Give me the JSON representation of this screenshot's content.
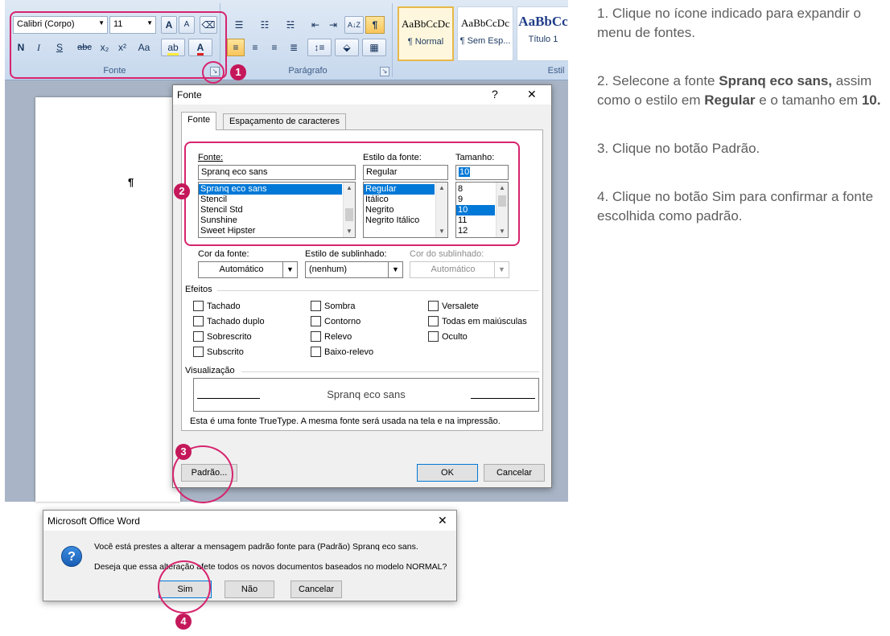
{
  "ribbon": {
    "font_name": "Calibri (Corpo)",
    "font_size": "11",
    "font_group_label": "Fonte",
    "paragraph_group_label": "Parágrafo",
    "styles_group_label": "Estil",
    "format_buttons": [
      "N",
      "I",
      "S",
      "abc",
      "x₂",
      "x²",
      "Aa"
    ],
    "grow_label": "A",
    "shrink_label": "A",
    "pilcrow_label": "¶",
    "sort_label": "A↓Z",
    "styles": [
      {
        "sample": "AaBbCcDc",
        "name": "¶ Normal"
      },
      {
        "sample": "AaBbCcDc",
        "name": "¶ Sem Esp..."
      },
      {
        "sample": "AaBbCc",
        "name": "Título 1"
      }
    ]
  },
  "document": {
    "pilcrow": "¶"
  },
  "font_dialog": {
    "title": "Fonte",
    "help": "?",
    "close": "✕",
    "tabs": [
      "Fonte",
      "Espaçamento de caracteres"
    ],
    "font_label": "Fonte:",
    "font_value": "Spranq eco sans",
    "font_list": [
      "Spranq eco sans",
      "Stencil",
      "Stencil Std",
      "Sunshine",
      "Sweet Hipster"
    ],
    "style_label": "Estilo da fonte:",
    "style_value": "Regular",
    "style_list": [
      "Regular",
      "Itálico",
      "Negrito",
      "Negrito Itálico"
    ],
    "size_label": "Tamanho:",
    "size_value": "10",
    "size_list": [
      "8",
      "9",
      "10",
      "11",
      "12"
    ],
    "color_label": "Cor da fonte:",
    "color_value": "Automático",
    "underline_label": "Estilo de sublinhado:",
    "underline_value": "(nenhum)",
    "underline_color_label": "Cor do sublinhado:",
    "underline_color_value": "Automático",
    "effects_label": "Efeitos",
    "effects": [
      "Tachado",
      "Sombra",
      "Versalete",
      "Tachado duplo",
      "Contorno",
      "Todas em maiúsculas",
      "Sobrescrito",
      "Relevo",
      "Oculto",
      "Subscrito",
      "Baixo-relevo"
    ],
    "preview_label": "Visualização",
    "preview_text": "Spranq eco sans",
    "truetype_note": "Esta é uma fonte TrueType. A mesma fonte será usada na tela e na impressão.",
    "default_button": "Padrão...",
    "ok_button": "OK",
    "cancel_button": "Cancelar"
  },
  "confirm_dialog": {
    "title": "Microsoft Office Word",
    "close": "✕",
    "icon": "?",
    "message1": "Você está prestes a alterar a mensagem padrão fonte para (Padrão) Spranq eco sans.",
    "message2": "Deseja que essa alteração afete todos os novos documentos baseados no modelo NORMAL?",
    "yes_button": "Sim",
    "no_button": "Não",
    "cancel_button": "Cancelar"
  },
  "badges": [
    "1",
    "2",
    "3",
    "4"
  ],
  "instructions": [
    {
      "text": "1. Clique no ícone indicado para expandir o menu de fontes."
    },
    {
      "pre": "2. Selecone a fonte ",
      "b1": "Spranq eco sans,",
      "mid": " assim como o estilo em ",
      "b2": "Regular",
      "mid2": " e o tamanho em ",
      "b3": "10."
    },
    {
      "text": "3. Clique no botão Padrão."
    },
    {
      "text": "4. Clique no botão Sim para confirmar a fonte escolhida como padrão."
    }
  ],
  "colors": {
    "accent": "#d6246e",
    "badge": "#c4185a",
    "selection": "#0078d7"
  }
}
